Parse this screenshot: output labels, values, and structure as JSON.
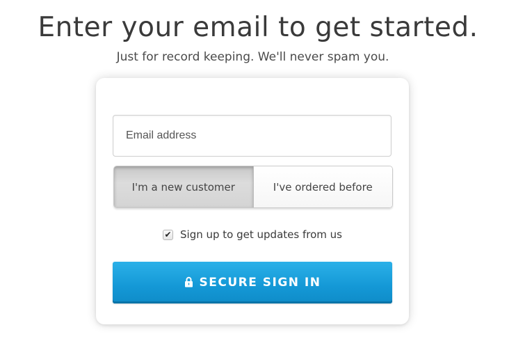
{
  "header": {
    "title": "Enter your email to get started.",
    "subtitle": "Just for record keeping. We'll never spam you."
  },
  "form": {
    "email_placeholder": "Email address",
    "email_value": "",
    "customer_toggle": {
      "options": [
        {
          "label": "I'm a new customer",
          "selected": true
        },
        {
          "label": "I've ordered before",
          "selected": false
        }
      ]
    },
    "newsletter": {
      "label": "Sign up to get updates from us",
      "checked": true
    },
    "submit": {
      "label": "SECURE SIGN IN",
      "icon": "lock-icon",
      "color": "#1a9fdc"
    }
  }
}
